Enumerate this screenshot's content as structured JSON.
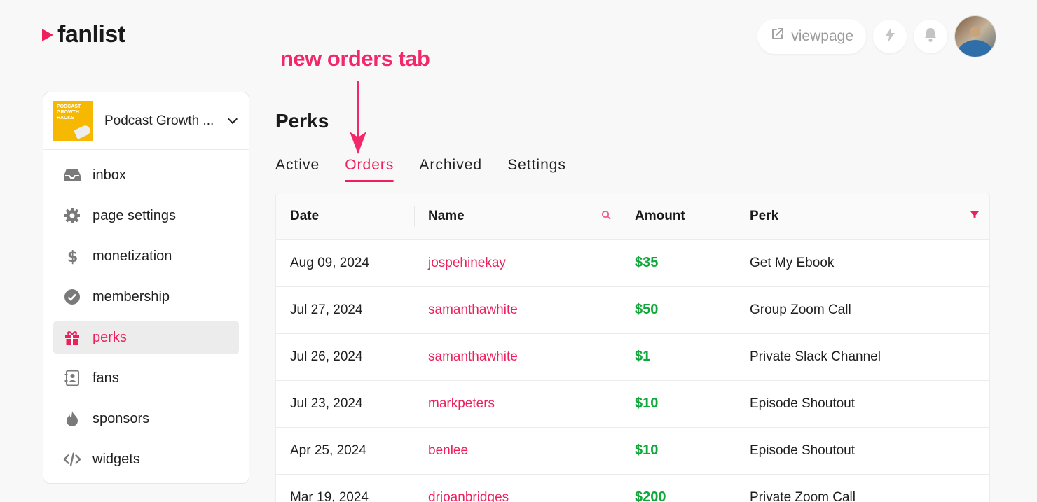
{
  "brand": {
    "name": "fanlist"
  },
  "header": {
    "viewpage_label": "viewpage"
  },
  "annotation": {
    "text": "new orders tab"
  },
  "workspace": {
    "name": "Podcast Growth ..."
  },
  "sidebar": {
    "items": [
      {
        "label": "inbox",
        "icon": "inbox-icon"
      },
      {
        "label": "page settings",
        "icon": "gear-icon"
      },
      {
        "label": "monetization",
        "icon": "dollar-icon"
      },
      {
        "label": "membership",
        "icon": "check-circle-icon"
      },
      {
        "label": "perks",
        "icon": "gift-icon",
        "active": true
      },
      {
        "label": "fans",
        "icon": "contact-book-icon"
      },
      {
        "label": "sponsors",
        "icon": "flame-icon"
      },
      {
        "label": "widgets",
        "icon": "code-icon"
      }
    ]
  },
  "main": {
    "title": "Perks",
    "tabs": [
      {
        "label": "Active"
      },
      {
        "label": "Orders",
        "active": true
      },
      {
        "label": "Archived"
      },
      {
        "label": "Settings"
      }
    ],
    "table": {
      "columns": [
        "Date",
        "Name",
        "Amount",
        "Perk"
      ],
      "rows": [
        {
          "date": "Aug 09, 2024",
          "name": "jospehinekay",
          "amount": "$35",
          "perk": "Get My Ebook"
        },
        {
          "date": "Jul 27, 2024",
          "name": "samanthawhite",
          "amount": "$50",
          "perk": "Group Zoom Call"
        },
        {
          "date": "Jul 26, 2024",
          "name": "samanthawhite",
          "amount": "$1",
          "perk": "Private Slack Channel"
        },
        {
          "date": "Jul 23, 2024",
          "name": "markpeters",
          "amount": "$10",
          "perk": "Episode Shoutout"
        },
        {
          "date": "Apr 25, 2024",
          "name": "benlee",
          "amount": "$10",
          "perk": "Episode Shoutout"
        },
        {
          "date": "Mar 19, 2024",
          "name": "drjoanbridges",
          "amount": "$200",
          "perk": "Private Zoom Call"
        }
      ]
    }
  },
  "colors": {
    "accent": "#ef1f5c",
    "amount": "#10a83a"
  }
}
